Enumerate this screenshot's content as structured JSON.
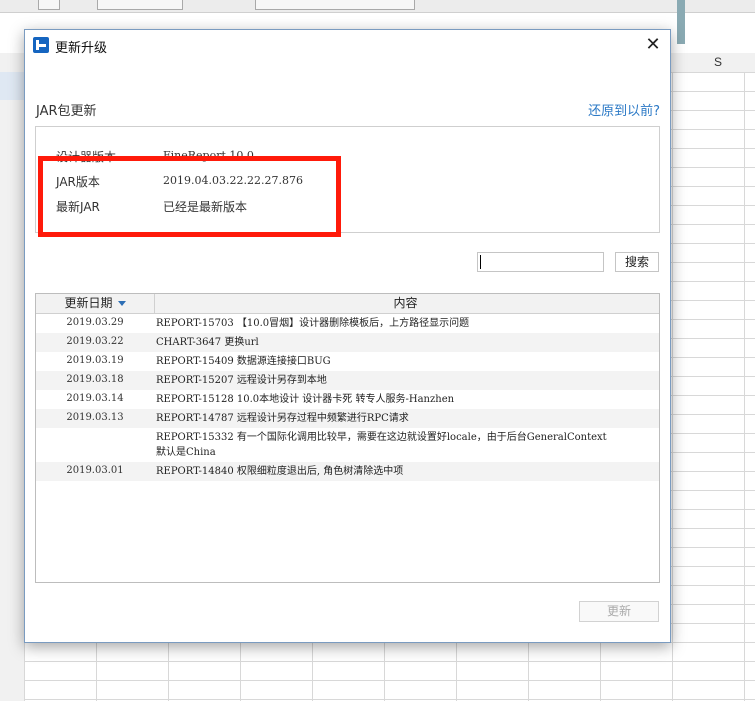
{
  "background": {
    "column_header_label": "S"
  },
  "dialog": {
    "title": "更新升级",
    "section_label": "JAR包更新",
    "restore_link": "还原到以前?",
    "info": [
      {
        "label": "设计器版本",
        "value": "FineReport 10.0"
      },
      {
        "label": "JAR版本",
        "value": "2019.04.03.22.22.27.876"
      },
      {
        "label": "最新JAR",
        "value": "已经是最新版本"
      }
    ],
    "search": {
      "placeholder": "",
      "button_label": "搜索"
    },
    "table": {
      "headers": {
        "date": "更新日期",
        "content": "内容"
      },
      "rows": [
        {
          "date": "2019.03.29",
          "content": "REPORT-15703 【10.0冒烟】设计器删除模板后，上方路径显示问题"
        },
        {
          "date": "2019.03.22",
          "content": "CHART-3647 更换url"
        },
        {
          "date": "2019.03.19",
          "content": "REPORT-15409 数据源连接接口BUG"
        },
        {
          "date": "2019.03.18",
          "content": "REPORT-15207 远程设计另存到本地"
        },
        {
          "date": "2019.03.14",
          "content": "REPORT-15128 10.0本地设计 设计器卡死 转专人服务-Hanzhen"
        },
        {
          "date": "2019.03.13",
          "content": "REPORT-14787 远程设计另存过程中频繁进行RPC请求"
        },
        {
          "date": "",
          "content": "REPORT-15332 有一个国际化调用比较早，需要在这边就设置好locale，由于后台GeneralContext\n默认是China"
        },
        {
          "date": "2019.03.01",
          "content": "REPORT-14840 权限细粒度退出后, 角色树清除选中项"
        }
      ]
    },
    "update_button": "更新"
  },
  "colors": {
    "highlight_border": "#ff1a0a",
    "link": "#2b79c6",
    "app_icon": "#1565c0"
  }
}
